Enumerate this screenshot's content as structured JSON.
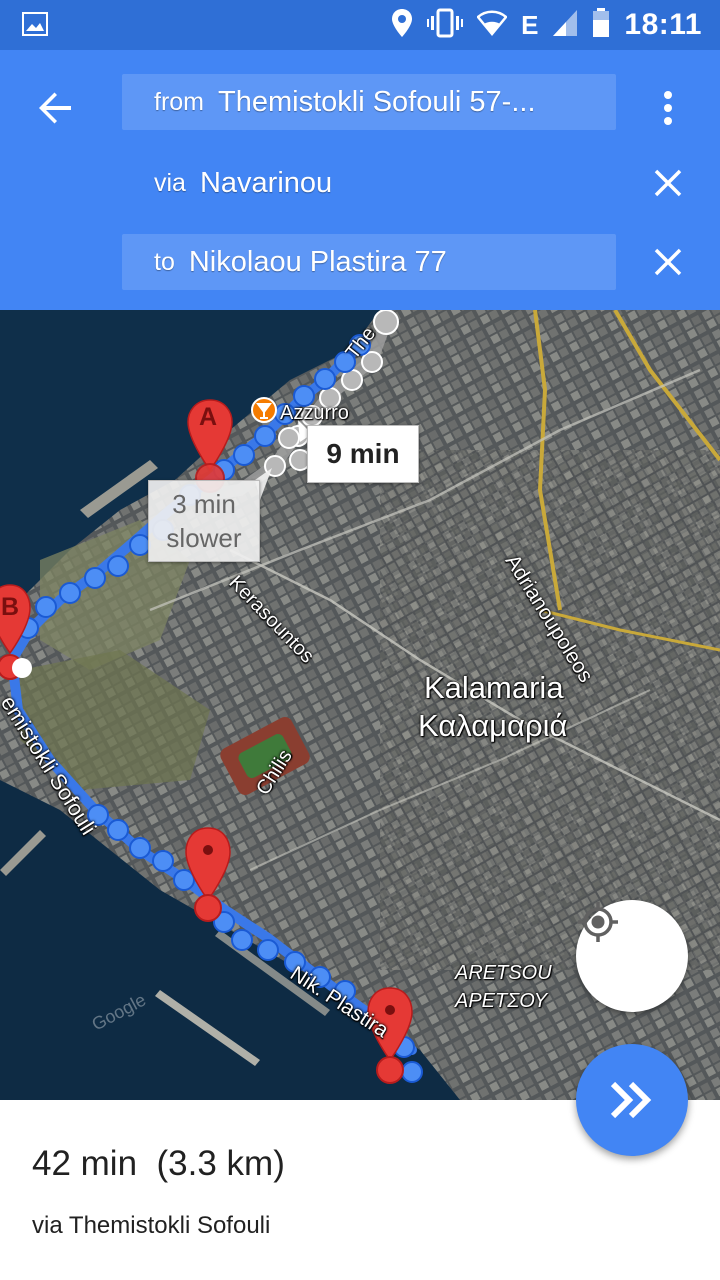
{
  "status_bar": {
    "time": "18:11",
    "network": "E",
    "icons": [
      "image-icon",
      "location-icon",
      "vibrate-icon",
      "wifi-icon",
      "signal-icon",
      "battery-icon"
    ]
  },
  "header": {
    "back_icon": "arrow-back-icon",
    "more_icon": "more-vert-icon",
    "from_prefix": "from",
    "from_value": "Themistokli Sofouli 57-...",
    "via_prefix": "via",
    "via_value": "Navarinou",
    "to_prefix": "to",
    "to_value": "Nikolaou Plastira 77",
    "close_icon": "close-icon",
    "bg_color": "#4285f4"
  },
  "map": {
    "labels": {
      "the": "The",
      "azzurro": "Azzurro",
      "adrianoupoleos": "Adrianoupoleos",
      "kerasountos": "Kerasountos",
      "kalamaria_en": "Kalamaria",
      "kalamaria_gr": "Καλαμαριά",
      "chilis": "Chilis",
      "themistokli": "emistokli Sofouli",
      "nik_plastira": "Nik. Plastira",
      "aretsou_en": "ARETSOU",
      "aretsou_gr": "ΑΡΕΤΣΟΥ",
      "watermark": "Google"
    },
    "callout_main": "9 min",
    "callout_alt_line1": "3 min",
    "callout_alt_line2": "slower",
    "marker_a": "A",
    "marker_b": "B",
    "route_color": "#4285f4",
    "alt_route_color": "#9e9e9e",
    "marker_color": "#e53935",
    "locate_icon": "my-location-icon"
  },
  "bottom": {
    "duration": "42 min",
    "distance": "(3.3 km)",
    "via": "via Themistokli Sofouli",
    "fab_icon": "double-chevron-right-icon"
  }
}
